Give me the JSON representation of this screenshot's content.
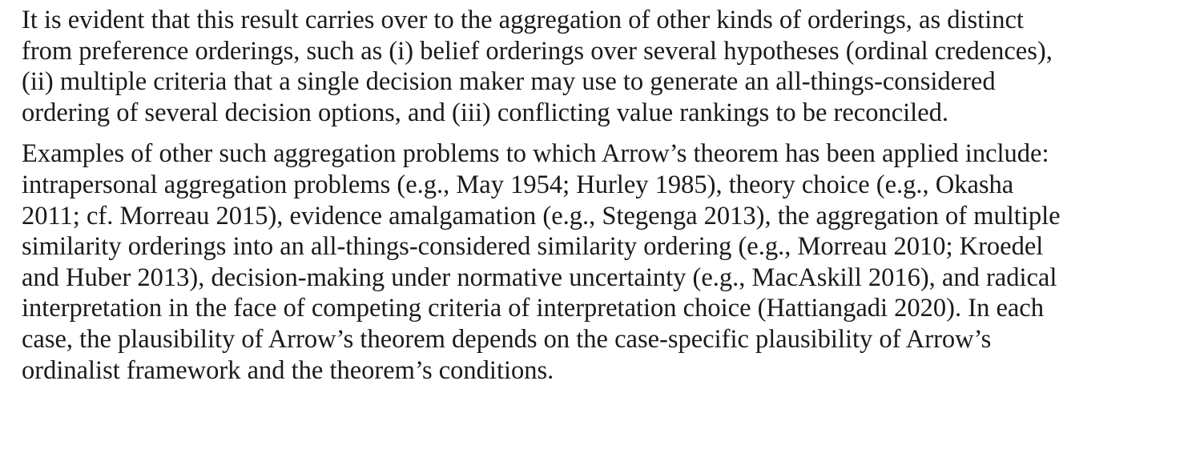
{
  "article": {
    "paragraphs": [
      {
        "lines": [
          "It is evident that this result carries over to the aggregation of other kinds of orderings, as distinct",
          "from preference orderings, such as (i) belief orderings over several hypotheses (ordinal credences),",
          "(ii) multiple criteria that a single decision maker may use to generate an all-things-considered",
          "ordering of several decision options, and (iii) conflicting value rankings to be reconciled."
        ]
      },
      {
        "lines": [
          "Examples of other such aggregation problems to which Arrow’s theorem has been applied include:",
          "intrapersonal aggregation problems (e.g., May 1954; Hurley 1985), theory choice (e.g., Okasha",
          "2011; cf. Morreau 2015), evidence amalgamation (e.g., Stegenga 2013), the aggregation of multiple",
          "similarity orderings into an all-things-considered similarity ordering (e.g., Morreau 2010; Kroedel",
          "and Huber 2013), decision-making under normative uncertainty (e.g., MacAskill 2016), and radical",
          "interpretation in the face of competing criteria of interpretation choice (Hattiangadi 2020). In each",
          "case, the plausibility of Arrow’s theorem depends on the case-specific plausibility of Arrow’s",
          "ordinalist framework and the theorem’s conditions."
        ]
      }
    ]
  },
  "colors": {
    "text": "#1a1a1a",
    "background": "#ffffff"
  }
}
